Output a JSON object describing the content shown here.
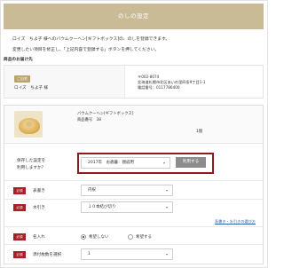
{
  "header": {
    "title": "のしの設定"
  },
  "intro": {
    "line1": "ロイズ　ちよ子 様へのバウムクーヘン[ギフトボックス]の、のしを登録できます。",
    "line2": "変更したい項目を修正し、「上記内容で登録する」ボタンを押してください。"
  },
  "section": {
    "title": "商品のお届け先"
  },
  "address": {
    "badge": "ご自宅",
    "name": "ロイズ　ちよ子 様",
    "postal": "〒002-8074",
    "street": "北海道札幌市北区あいの里四条9丁目1-1",
    "phone": "電話番号：0117786400"
  },
  "item": {
    "image": "baumkuchen-image",
    "name": "バウムクーヘン[ギフトボックス]",
    "code": "商品番号　38",
    "qty": "1個"
  },
  "saved": {
    "label_line1": "保存した設定を",
    "label_line2": "利用しますか？",
    "select_value": "2017年　お歳暮：親戚用",
    "use_button": "利用する"
  },
  "fields": {
    "omotegaki": {
      "badge": "必須",
      "label": "表書き",
      "value": "内祝"
    },
    "mizuhiki": {
      "badge": "必須",
      "label": "水引き",
      "value": "１０本結び切り"
    },
    "link_text": "表書き・水引きの選び方",
    "nairie": {
      "badge": "必須",
      "label": "名入れ",
      "opt_no": "希望しない",
      "opt_yes": "希望する"
    },
    "attach_count": {
      "badge": "必須",
      "label": "添付枚数を選択",
      "value": "1"
    }
  },
  "icons": {
    "dropdown": "chevron-down-icon"
  },
  "colors": {
    "header_bg": "#c8bb96",
    "required_badge": "#a81f25",
    "highlight_border": "#8b1c1c",
    "use_button_bg": "#8c8c8c"
  }
}
